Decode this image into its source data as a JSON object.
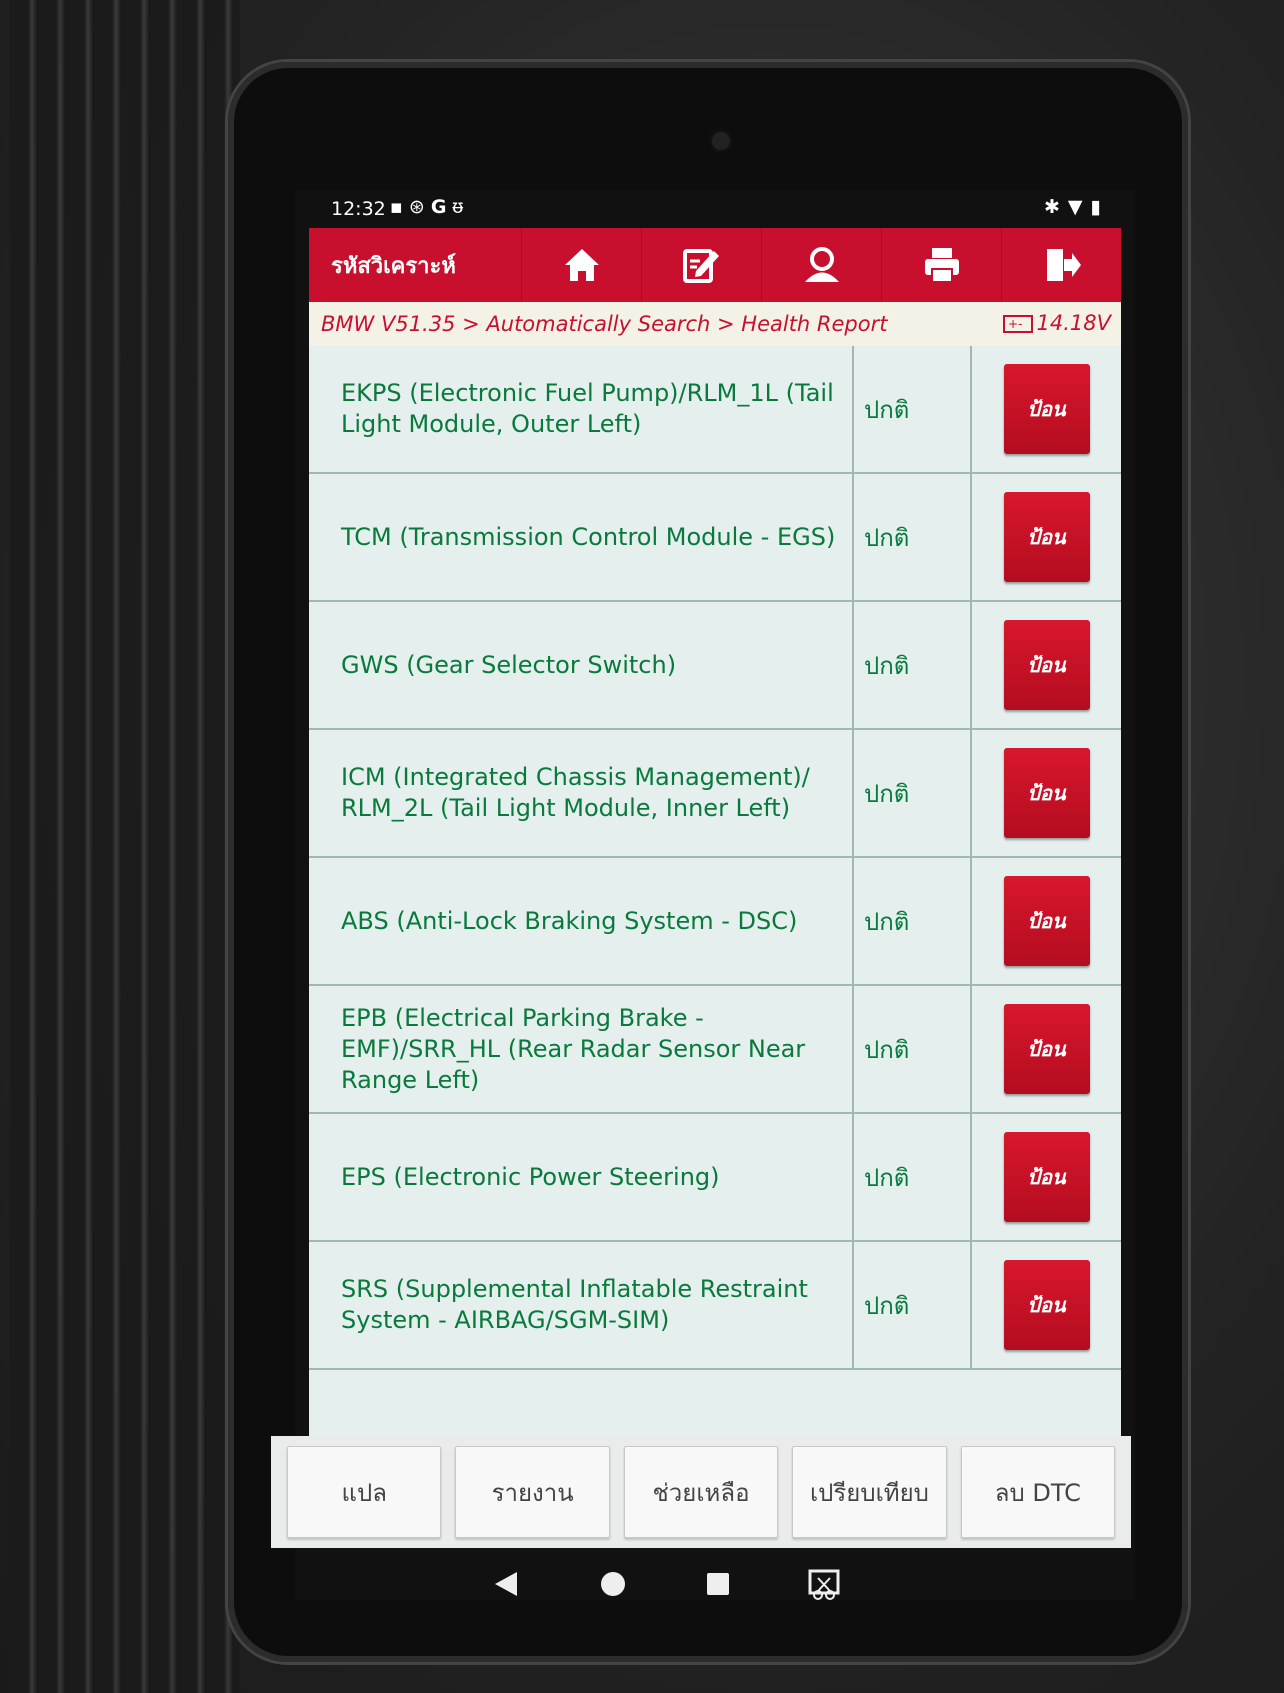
{
  "status_bar": {
    "time": "12:32",
    "left_icons": [
      "image-icon",
      "accessibility-icon",
      "google-icon",
      "stethoscope-icon"
    ],
    "right_icons": [
      "bluetooth-icon",
      "wifi-icon",
      "battery-icon"
    ]
  },
  "toolbar": {
    "title": "รหัสวิเคราะห์",
    "buttons": [
      "home-icon",
      "edit-icon",
      "user-icon",
      "print-icon",
      "exit-icon"
    ]
  },
  "breadcrumb": {
    "path": "BMW V51.35 > Automatically Search > Health Report",
    "voltage": "14.18V"
  },
  "modules": [
    {
      "name": "EKPS (Electronic Fuel Pump)/RLM_1L (Tail Light Module, Outer Left)",
      "status": "ปกติ",
      "action": "ป้อน"
    },
    {
      "name": "TCM (Transmission Control Module - EGS)",
      "status": "ปกติ",
      "action": "ป้อน"
    },
    {
      "name": "GWS (Gear Selector Switch)",
      "status": "ปกติ",
      "action": "ป้อน"
    },
    {
      "name": "ICM (Integrated Chassis Management)/ RLM_2L (Tail Light Module, Inner Left)",
      "status": "ปกติ",
      "action": "ป้อน"
    },
    {
      "name": "ABS (Anti-Lock Braking System - DSC)",
      "status": "ปกติ",
      "action": "ป้อน"
    },
    {
      "name": "EPB (Electrical Parking Brake - EMF)/SRR_HL (Rear Radar Sensor Near Range Left)",
      "status": "ปกติ",
      "action": "ป้อน"
    },
    {
      "name": "EPS (Electronic Power Steering)",
      "status": "ปกติ",
      "action": "ป้อน"
    },
    {
      "name": "SRS (Supplemental Inflatable Restraint System - AIRBAG/SGM-SIM)",
      "status": "ปกติ",
      "action": "ป้อน"
    }
  ],
  "bottom_actions": {
    "translate": "แปล",
    "report": "รายงาน",
    "help": "ช่วยเหลือ",
    "compare": "เปรียบเทียบ",
    "clear_dtc": "ลบ DTC"
  },
  "nav": [
    "back-icon",
    "home-icon",
    "recents-icon",
    "screenshot-icon"
  ],
  "colors": {
    "accent": "#c8102e",
    "ok_text": "#0a7a3c",
    "list_bg": "#e4efee"
  }
}
